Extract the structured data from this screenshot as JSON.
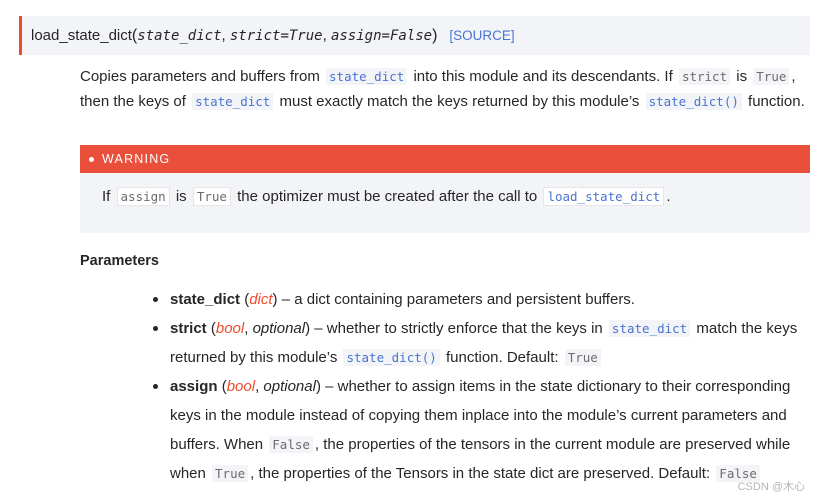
{
  "signature": {
    "name": "load_state_dict",
    "open_paren": "(",
    "args": [
      "state_dict",
      "strict=True",
      "assign=False"
    ],
    "close_paren": ")",
    "source_label": "[SOURCE]"
  },
  "description": {
    "t1": "Copies parameters and buffers from ",
    "c1": "state_dict",
    "t2": " into this module and its descendants. If ",
    "c2": "strict",
    "t3": " is ",
    "c3": "True",
    "t4": ", then the keys of ",
    "c4": "state_dict",
    "t5": " must exactly match the keys returned by this module’s ",
    "c5": "state_dict()",
    "t6": " function."
  },
  "warning": {
    "title": "WARNING",
    "t1": "If ",
    "c1": "assign",
    "t2": " is ",
    "c2": "True",
    "t3": " the optimizer must be created after the call to ",
    "c3": "load_state_dict",
    "t4": "."
  },
  "parameters": {
    "title": "Parameters",
    "items": [
      {
        "name": "state_dict",
        "type": "dict",
        "optional": "",
        "text": " – a dict containing parameters and persistent buffers."
      },
      {
        "name": "strict",
        "type": "bool",
        "optional": "optional",
        "t1": " – whether to strictly enforce that the keys in ",
        "c1": "state_dict",
        "t2": " match the keys returned by this module’s ",
        "c2": "state_dict()",
        "t3": " function. Default: ",
        "c3": "True"
      },
      {
        "name": "assign",
        "type": "bool",
        "optional": "optional",
        "t1": " – whether to assign items in the state dictionary to their corresponding keys in the module instead of copying them inplace into the module’s current parameters and buffers. When ",
        "c1": "False",
        "t2": ", the properties of the tensors in the current module are preserved while when ",
        "c2": "True",
        "t3": ", the properties of the Tensors in the state dict are preserved. Default: ",
        "c3": "False"
      }
    ]
  },
  "watermark": "CSDN @木心",
  "colors": {
    "accent": "#ee4c2c",
    "warning_header": "#e94f3b",
    "link": "#4974d1",
    "code_bg": "#f3f4f7"
  }
}
